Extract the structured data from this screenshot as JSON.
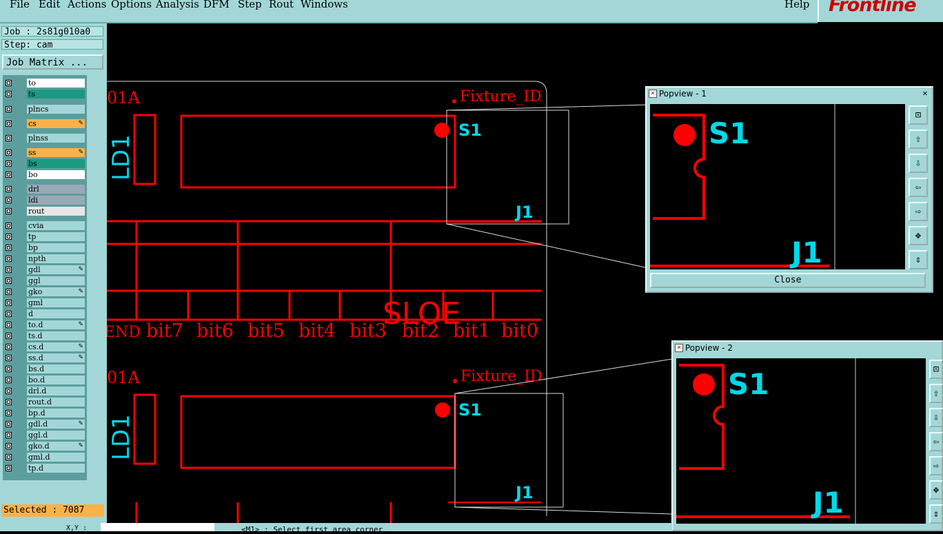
{
  "menubar": {
    "items": [
      "File",
      "Edit",
      "Actions",
      "Options",
      "Analysis",
      "DFM",
      "Step",
      "Rout",
      "Windows"
    ],
    "help": "Help",
    "logo": "Frontline"
  },
  "left": {
    "job": "Job : 2s81g010a0",
    "step": "Step: cam",
    "job_matrix": "Job Matrix ...",
    "layers": [
      "to",
      "ts",
      "plncs",
      "cs",
      "plnss",
      "ss",
      "bs",
      "bo",
      "drl",
      "ldi",
      "rout",
      "cvia",
      "tp",
      "bp",
      "npth",
      "gdl",
      "ggl",
      "gko",
      "gml",
      "d",
      "to.d",
      "ts.d",
      "cs.d",
      "ss.d",
      "bs.d",
      "bo.d",
      "drl.d",
      "rout.d",
      "bp.d",
      "gdl.d",
      "ggl.d",
      "gko.d",
      "gml.d",
      "tp.d"
    ],
    "selected": "Selected : 7087"
  },
  "canvas": {
    "board_top_label": "01A",
    "fixture": "Fixture_ID",
    "ld": "LD1",
    "s1": "S1",
    "j1": "J1",
    "bits": [
      "END",
      "bit7",
      "bit6",
      "bit5",
      "bit4",
      "bit3",
      "bit2",
      "bit1",
      "bit0"
    ],
    "logo_text": "SLOE"
  },
  "popview1": {
    "title": "Popview - 1",
    "close": "Close"
  },
  "popview2": {
    "title": "Popview - 2"
  },
  "status": {
    "prompt": "<M1> : Select first area corner",
    "xy": "X,Y :"
  },
  "colors": {
    "panel": "#a3d7d7",
    "trace": "#ff0000",
    "silk": "#00d8e8"
  }
}
